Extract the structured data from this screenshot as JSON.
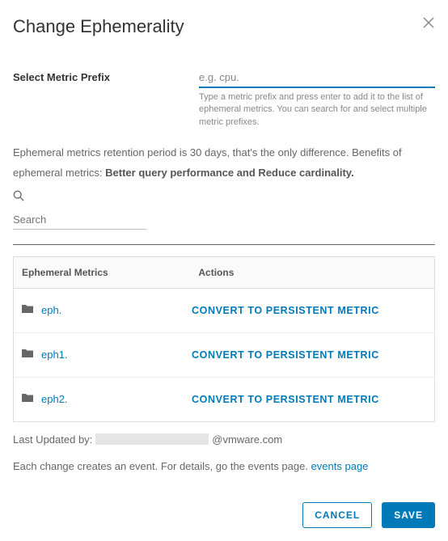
{
  "dialog": {
    "title": "Change Ephemerality"
  },
  "prefix_field": {
    "label": "Select Metric Prefix",
    "placeholder": "e.g. cpu.",
    "value": "",
    "helper": "Type a metric prefix and press enter to add it to the list of ephemeral metrics. You can search for and select multiple metric prefixes."
  },
  "description": {
    "text_before": "Ephemeral metrics retention period is 30 days, that's the only difference. Benefits of ephemeral metrics: ",
    "bold": "Better query performance and Reduce cardinality."
  },
  "search": {
    "placeholder": "Search",
    "value": ""
  },
  "table": {
    "headers": {
      "metrics": "Ephemeral Metrics",
      "actions": "Actions"
    },
    "action_label": "CONVERT TO PERSISTENT METRIC",
    "rows": [
      {
        "name": "eph."
      },
      {
        "name": "eph1."
      },
      {
        "name": "eph2."
      }
    ]
  },
  "updated": {
    "prefix": "Last Updated by:",
    "suffix": "@vmware.com"
  },
  "events_note": {
    "text": "Each change creates an event. For details, go the events page. ",
    "link": "events page"
  },
  "footer": {
    "cancel": "CANCEL",
    "save": "SAVE"
  }
}
